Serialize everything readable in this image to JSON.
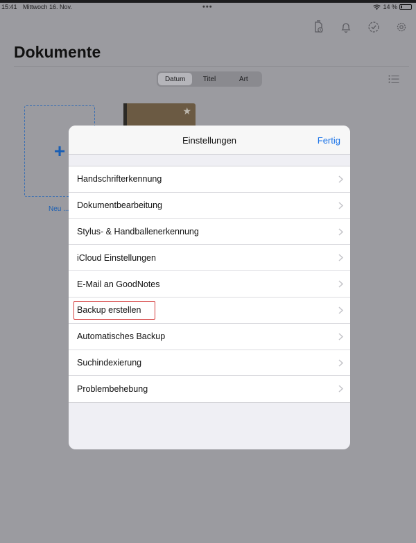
{
  "status": {
    "time": "15:41",
    "date": "Mittwoch 16. Nov.",
    "dots": "•••",
    "battery": "14 %"
  },
  "icons": {
    "toolbar": [
      "document-sync-icon",
      "bell-icon",
      "checkmark-circle-icon",
      "gear-icon"
    ],
    "list_view": "list-view-icon",
    "new_document": "plus-icon",
    "favorite": "star-icon",
    "row_disclosure": "chevron-right-icon"
  },
  "header": {
    "title": "Dokumente"
  },
  "sort": {
    "options": [
      "Datum",
      "Titel",
      "Art"
    ],
    "active": "Datum"
  },
  "library": {
    "new_label": "Neu ...",
    "plus": "+",
    "star": "★"
  },
  "settings_modal": {
    "title": "Einstellungen",
    "done_label": "Fertig",
    "items": [
      "Handschrifterkennung",
      "Dokumentbearbeitung",
      "Stylus- & Handballenerkennung",
      "iCloud Einstellungen",
      "E-Mail an GoodNotes",
      "Backup erstellen",
      "Automatisches Backup",
      "Suchindexierung",
      "Problembehebung"
    ],
    "highlighted_item": "Backup erstellen"
  },
  "colors": {
    "accent": "#1a73e8",
    "highlight": "#d43c3c"
  }
}
